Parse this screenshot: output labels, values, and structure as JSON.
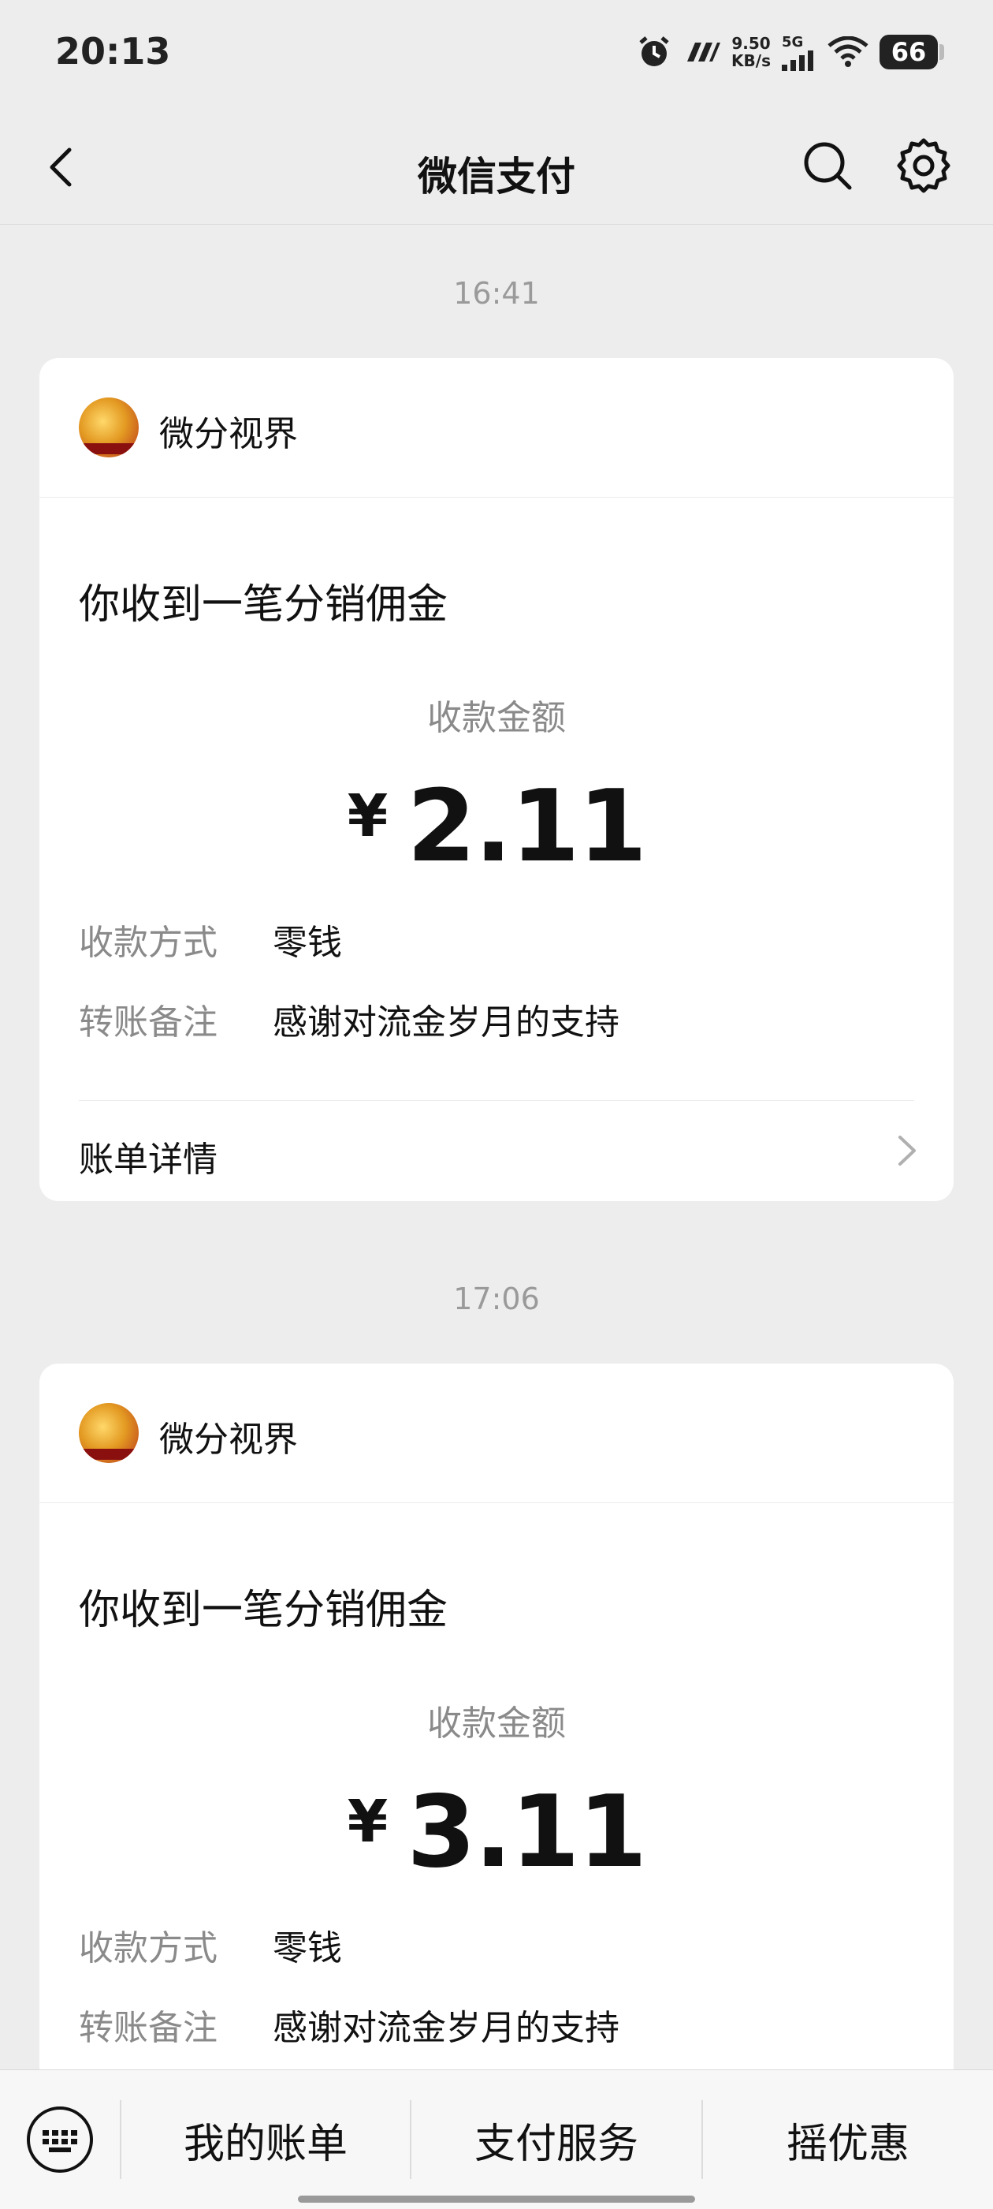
{
  "status_bar": {
    "time": "20:13",
    "net_speed_value": "9.50",
    "net_speed_unit": "KB/s",
    "network": "5G",
    "battery": "66",
    "icons": [
      "alarm-icon",
      "app-badge-icon",
      "signal-icon",
      "wifi-icon",
      "battery-icon"
    ]
  },
  "header": {
    "title": "微信支付",
    "icons": [
      "back-arrow-icon",
      "search-icon",
      "gear-icon"
    ]
  },
  "messages": [
    {
      "time": "16:41",
      "merchant": "微分视界",
      "title": "你收到一笔分销佣金",
      "amount_label": "收款金额",
      "currency": "¥",
      "amount": "2.11",
      "method_label": "收款方式",
      "method_value": "零钱",
      "note_label": "转账备注",
      "note_value": "感谢对流金岁月的支持",
      "detail_label": "账单详情"
    },
    {
      "time": "17:06",
      "merchant": "微分视界",
      "title": "你收到一笔分销佣金",
      "amount_label": "收款金额",
      "currency": "¥",
      "amount": "3.11",
      "method_label": "收款方式",
      "method_value": "零钱",
      "note_label": "转账备注",
      "note_value": "感谢对流金岁月的支持"
    }
  ],
  "bottom_bar": {
    "keyboard_icon": "keyboard-icon",
    "menus": [
      "我的账单",
      "支付服务",
      "摇优惠"
    ]
  }
}
